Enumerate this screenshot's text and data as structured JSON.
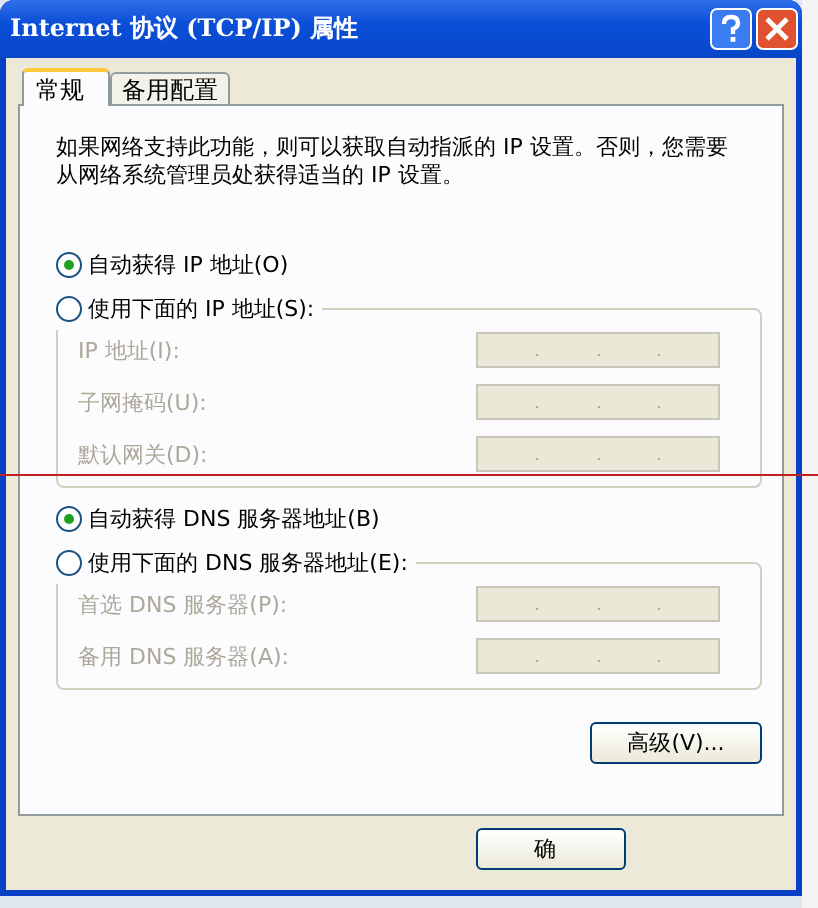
{
  "window": {
    "title": "Internet 协议 (TCP/IP) 属性"
  },
  "tabs": [
    {
      "label": "常规",
      "selected": true
    },
    {
      "label": "备用配置",
      "selected": false
    }
  ],
  "description": "如果网络支持此功能，则可以获取自动指派的 IP 设置。否则，您需要从网络系统管理员处获得适当的 IP 设置。",
  "ip_section": {
    "radios": [
      {
        "label": "自动获得 IP 地址(O)",
        "selected": true
      },
      {
        "label": "使用下面的 IP 地址(S):",
        "selected": false
      }
    ],
    "fields": [
      {
        "label": "IP 地址(I):",
        "disabled": true
      },
      {
        "label": "子网掩码(U):",
        "disabled": true
      },
      {
        "label": "默认网关(D):",
        "disabled": true
      }
    ]
  },
  "dns_section": {
    "radios": [
      {
        "label": "自动获得 DNS 服务器地址(B)",
        "selected": true
      },
      {
        "label": "使用下面的 DNS 服务器地址(E):",
        "selected": false
      }
    ],
    "fields": [
      {
        "label": "首选 DNS 服务器(P):",
        "disabled": true
      },
      {
        "label": "备用 DNS 服务器(A):",
        "disabled": true
      }
    ]
  },
  "advanced_button": "高级(V)...",
  "ok_button": "确"
}
